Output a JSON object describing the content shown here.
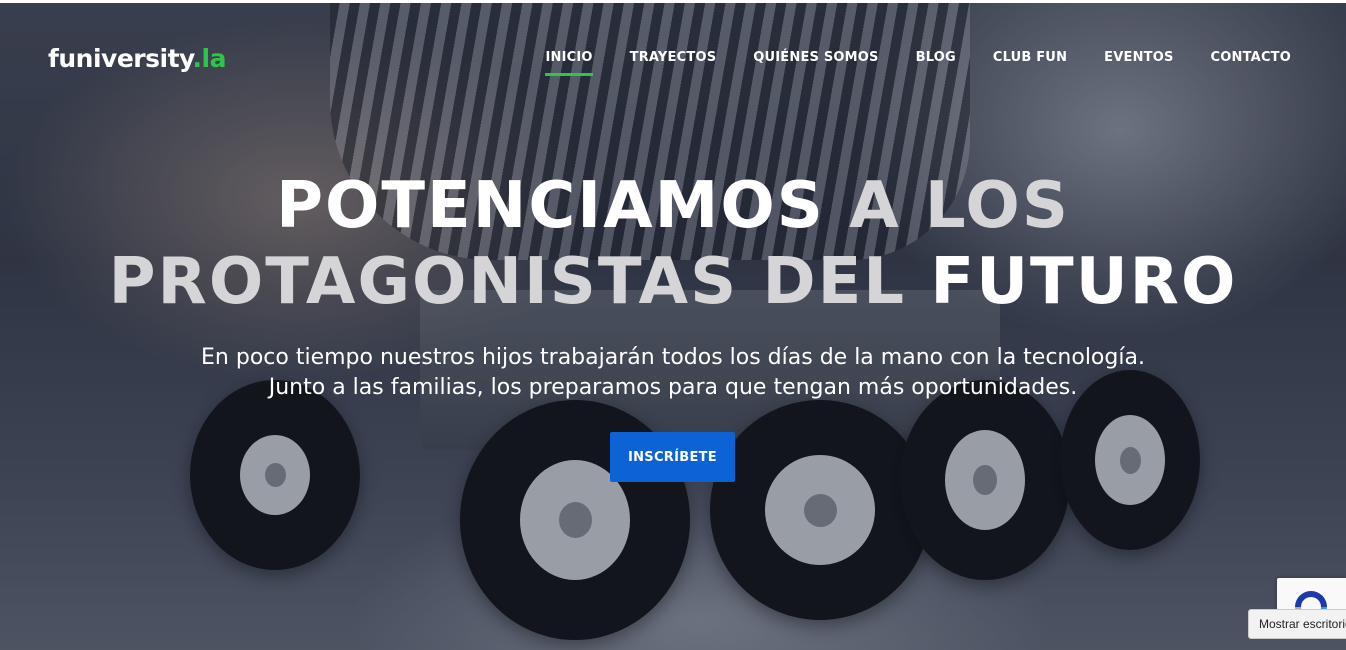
{
  "logo": {
    "main": "funiversity",
    "accent": ".la"
  },
  "nav": [
    {
      "label": "INICIO",
      "active": true
    },
    {
      "label": "TRAYECTOS",
      "active": false
    },
    {
      "label": "QUIÉNES SOMOS",
      "active": false
    },
    {
      "label": "BLOG",
      "active": false
    },
    {
      "label": "CLUB FUN",
      "active": false
    },
    {
      "label": "EVENTOS",
      "active": false
    },
    {
      "label": "CONTACTO",
      "active": false
    }
  ],
  "hero": {
    "headline": {
      "line1_white": "POTENCIAMOS",
      "line1_gray": "A LOS",
      "line2_gray": "PROTAGONISTAS DEL",
      "line2_white": "FUTURO"
    },
    "subtitle_line1": "En poco tiempo nuestros hijos trabajarán todos los días de la mano con la tecnología.",
    "subtitle_line2": "Junto a las familias, los preparamos para que tengan más oportunidades.",
    "cta_label": "INSCRÍBETE"
  },
  "recaptcha": {
    "icon": "recaptcha-icon",
    "tooltip": "Mostrar escritorio"
  },
  "colors": {
    "accent_green": "#2ec54a",
    "cta_blue": "#0d63d6",
    "headline_gray": "#d5d5d7"
  }
}
